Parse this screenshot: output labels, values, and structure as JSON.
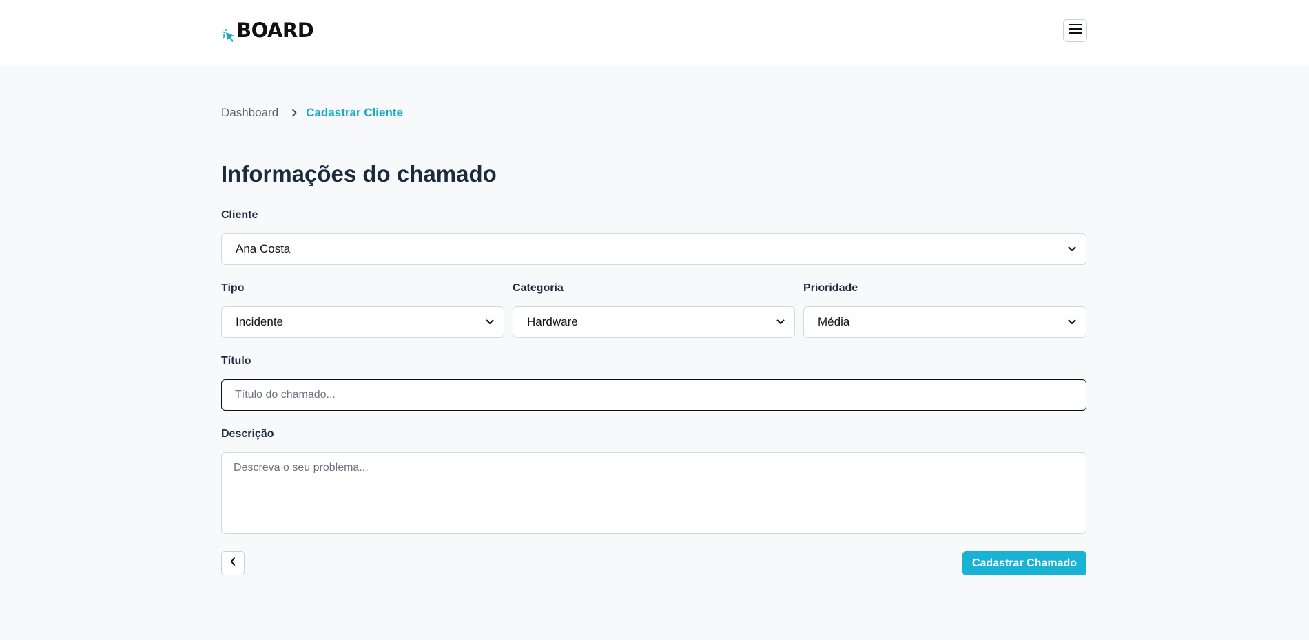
{
  "header": {
    "logo_text": "BOARD",
    "logo_icon": "cursor-click-icon",
    "menu_icon": "hamburger-menu-icon"
  },
  "breadcrumb": {
    "home": "Dashboard",
    "separator_icon": "chevron-right-icon",
    "current": "Cadastrar Cliente"
  },
  "form": {
    "title": "Informações do chamado",
    "cliente": {
      "label": "Cliente",
      "value": "Ana Costa"
    },
    "tipo": {
      "label": "Tipo",
      "value": "Incidente"
    },
    "categoria": {
      "label": "Categoria",
      "value": "Hardware"
    },
    "prioridade": {
      "label": "Prioridade",
      "value": "Média"
    },
    "titulo": {
      "label": "Título",
      "value": "",
      "placeholder": "Título do chamado..."
    },
    "descricao": {
      "label": "Descrição",
      "value": "",
      "placeholder": "Descreva o seu problema..."
    }
  },
  "actions": {
    "back_icon": "chevron-left-icon",
    "submit_label": "Cadastrar Chamado"
  },
  "colors": {
    "accent": "#17b2d4",
    "breadcrumb_active": "#17a9c9",
    "page_background": "#f7f9fb",
    "heading": "#1b2a3c"
  }
}
